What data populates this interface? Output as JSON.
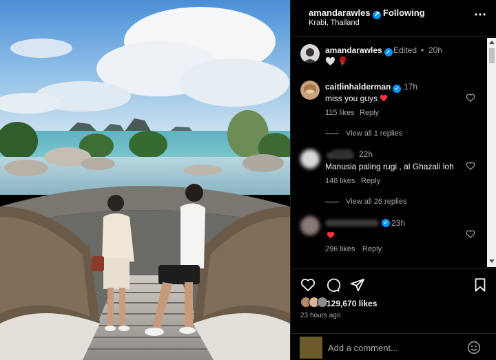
{
  "post": {
    "username": "amandarawles",
    "verified_mark": "✓",
    "separator": "•",
    "follow_status": "Following",
    "location": "Krabi, Thailand",
    "more_icon": "more-options-icon"
  },
  "caption": {
    "username": "amandarawles",
    "edited": "Edited",
    "time": "20h",
    "text": "🤍 🌹"
  },
  "comments": [
    {
      "username": "caitlinhalderman",
      "time": "17h",
      "text": "miss you guys",
      "likes": "115 likes",
      "reply": "Reply",
      "view_replies": "View all 1 replies"
    },
    {
      "username": "",
      "time": "22h",
      "text": "Manusia paling rugi , al Ghazali loh",
      "likes": "148 likes",
      "reply": "Reply",
      "view_replies": "View all 26 replies"
    },
    {
      "username": "",
      "time": "23h",
      "text": "",
      "likes": "296 likes",
      "reply": "Reply",
      "view_replies": ""
    }
  ],
  "actions": {
    "likes": "129,670 likes",
    "time_ago": "23 hours ago"
  },
  "add_comment": {
    "placeholder": "Add a comment..."
  },
  "colors": {
    "background": "#000000",
    "text": "#f5f5f5",
    "secondary_text": "#a8a8a8",
    "verified": "#0095f6",
    "heart": "#ff3040",
    "divider": "#262626"
  }
}
